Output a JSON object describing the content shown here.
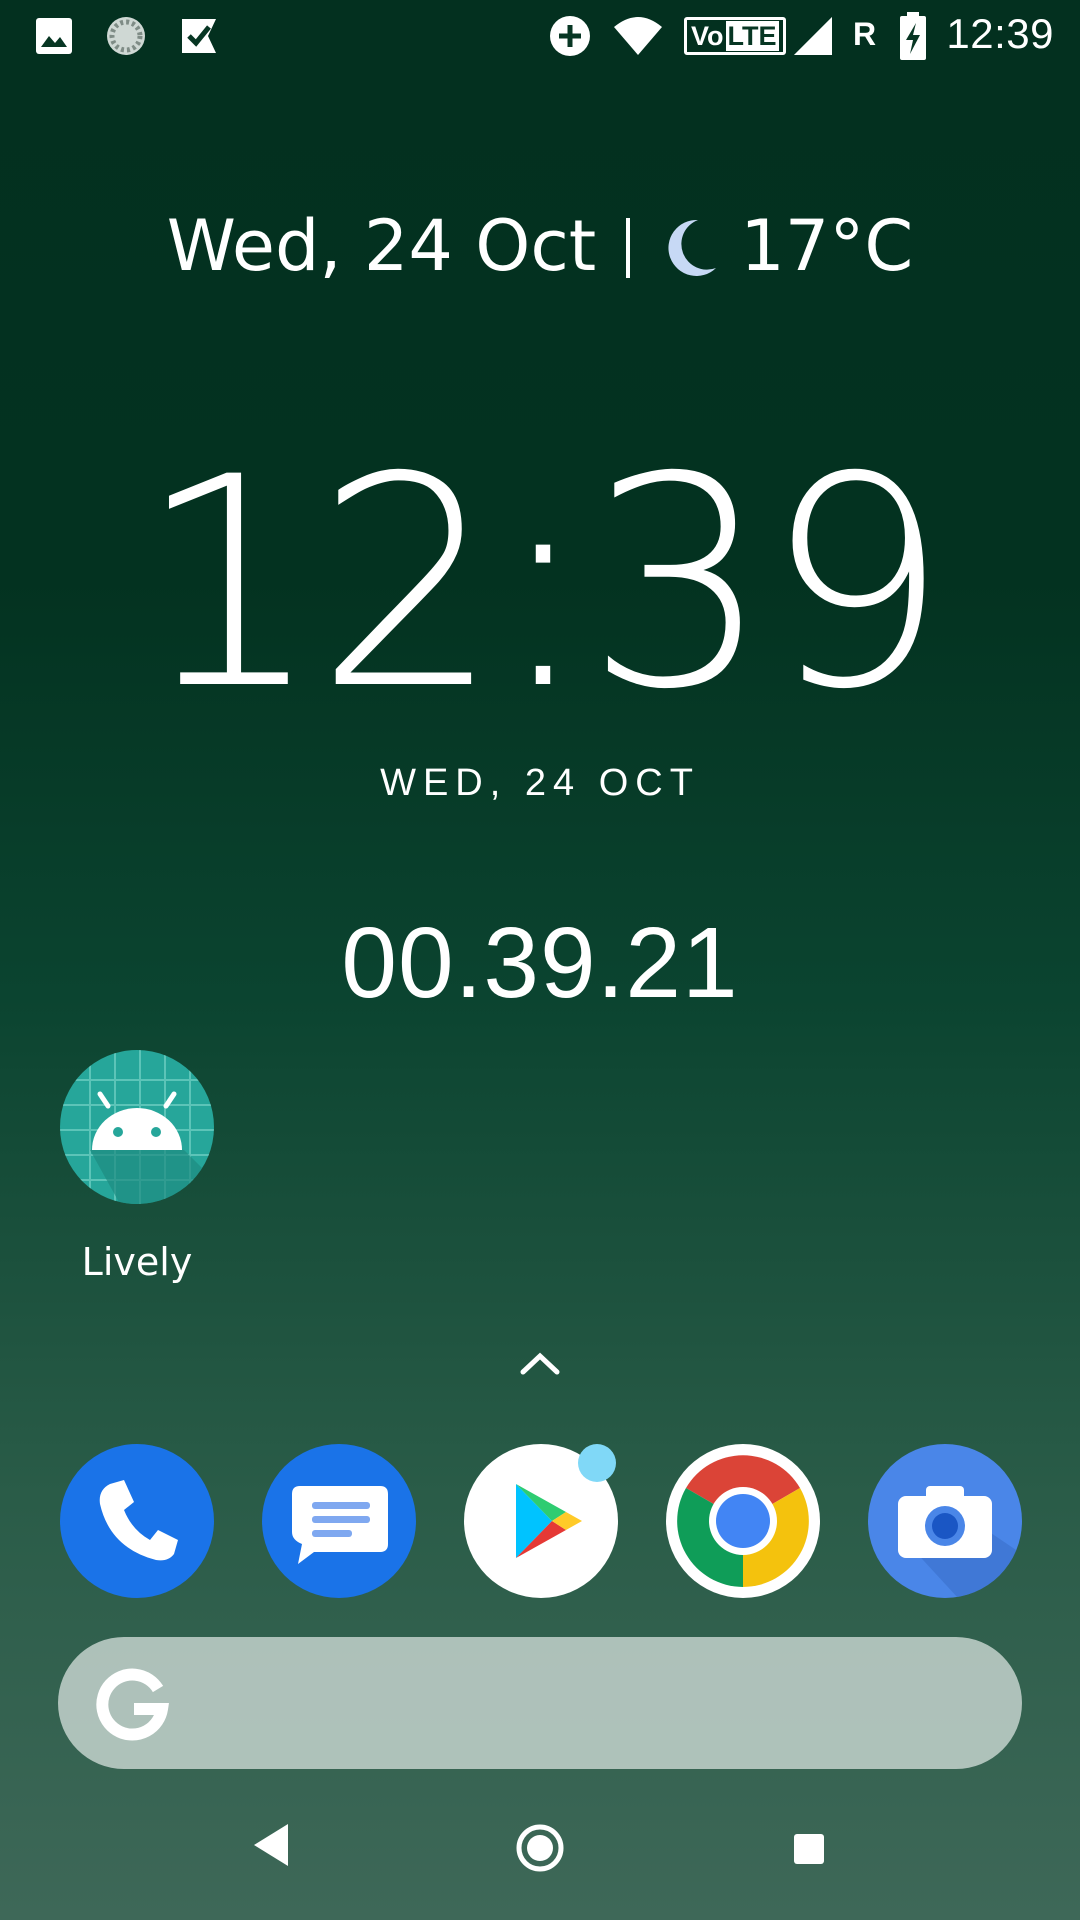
{
  "status_bar": {
    "time": "12:39",
    "network_badge": "VoLTE",
    "network_badge_a": "Vo",
    "network_badge_b": "LTE",
    "roaming": "R",
    "icons": [
      "gallery-notification-icon",
      "sync-notification-icon",
      "tasks-notification-icon",
      "data-saver-icon",
      "wifi-icon",
      "volte-icon",
      "cell-signal-icon",
      "roaming-icon",
      "battery-charging-icon"
    ]
  },
  "at_a_glance": {
    "date": "Wed, 24 Oct",
    "weather_icon": "moon-icon",
    "temperature": "17°C"
  },
  "clock_widget": {
    "time": "12:39",
    "date": "WED, 24 OCT"
  },
  "stopwatch": {
    "value": "00.39.21"
  },
  "home_apps": [
    {
      "label": "Lively",
      "icon": "android-icon",
      "color": "#26a69a"
    }
  ],
  "dock": [
    {
      "name": "phone",
      "icon": "phone-icon",
      "color": "#1a73e8"
    },
    {
      "name": "messages",
      "icon": "messages-icon",
      "color": "#1a73e8"
    },
    {
      "name": "play-store",
      "icon": "play-store-icon",
      "color": "#ffffff",
      "badge": true
    },
    {
      "name": "chrome",
      "icon": "chrome-icon",
      "color": "#ffffff"
    },
    {
      "name": "camera",
      "icon": "camera-icon",
      "color": "#4a86e8"
    }
  ],
  "search": {
    "icon": "google-g-icon"
  },
  "navigation": [
    "back-icon",
    "home-icon",
    "recents-icon"
  ],
  "colors": {
    "background_top": "#03301f",
    "background_bottom": "#3e6858",
    "accent_blue": "#1a73e8"
  }
}
